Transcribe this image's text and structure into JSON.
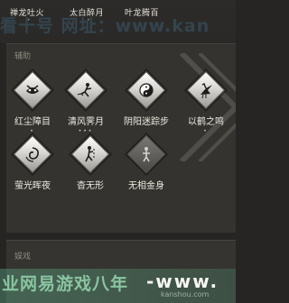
{
  "top_skills": [
    {
      "name": "禅龙吐火",
      "dots": "•"
    },
    {
      "name": "太白醉月",
      "dots": "•"
    },
    {
      "name": "叶龙腾百",
      "dots": ""
    }
  ],
  "watermark_header": "看十号  网址：www.kan",
  "section_assist": {
    "title": "辅助",
    "skills": [
      {
        "name": "红尘障目",
        "dots": "•",
        "icon": "mask-icon"
      },
      {
        "name": "清风霁月",
        "dots": "•••",
        "icon": "wind-figure-icon"
      },
      {
        "name": "阴阳迷踪步",
        "dots": "",
        "icon": "yinyang-icon"
      },
      {
        "name": "以鹤之鸣",
        "dots": "•",
        "icon": "crane-icon"
      },
      {
        "name": "萤光晖夜",
        "dots": "",
        "icon": "swirl-icon"
      },
      {
        "name": "杳无形",
        "dots": "",
        "icon": "shadow-figure-icon"
      },
      {
        "name": "无相金身",
        "dots": "",
        "icon": "golden-body-icon"
      }
    ]
  },
  "section_entertainment": {
    "title": "娱戏"
  },
  "watermark_footer": {
    "cn": "业网易游戏八年",
    "url": "-www.",
    "small": "kanshou.com"
  },
  "colors": {
    "background": "#262524",
    "panel": "#34332f",
    "text": "#efebe3",
    "watermark_green": "#96d7af"
  }
}
